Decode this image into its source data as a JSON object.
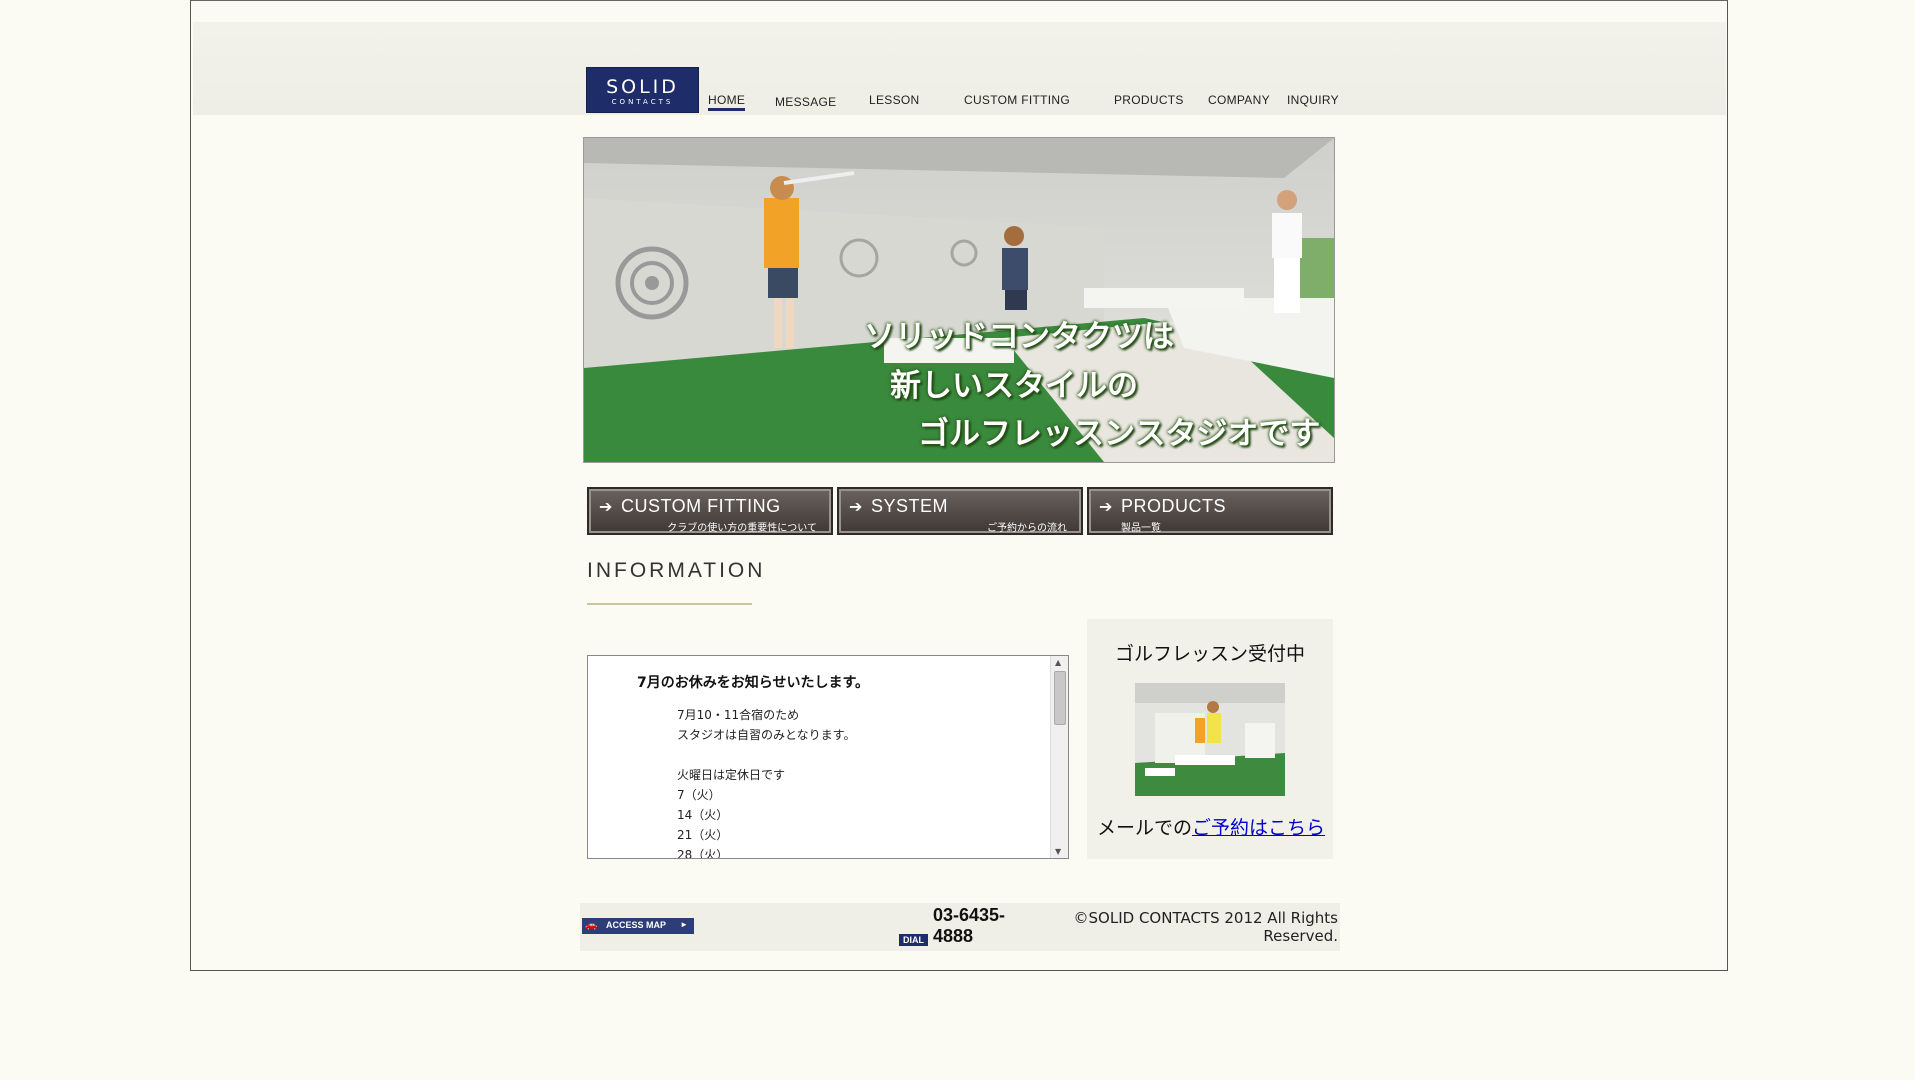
{
  "logo": {
    "line1": "SOLID",
    "line2": "CONTACTS"
  },
  "nav": {
    "items": [
      {
        "label": "HOME",
        "active": true
      },
      {
        "label": "MESSAGE"
      },
      {
        "label": "LESSON"
      },
      {
        "label": "CUSTOM FITTING"
      },
      {
        "label": "PRODUCTS"
      },
      {
        "label": "COMPANY"
      },
      {
        "label": "INQUIRY"
      }
    ]
  },
  "hero": {
    "caption_lines": [
      "ソリッドコンタクツは",
      "新しいスタイルの",
      "ゴルフレッスンスタジオです"
    ]
  },
  "buttons": [
    {
      "arrow": "➔",
      "title": "CUSTOM FITTING",
      "sub": "クラブの使い方の重要性について"
    },
    {
      "arrow": "➔",
      "title": "SYSTEM",
      "sub": "ご予約からの流れ"
    },
    {
      "arrow": "➔",
      "title": "PRODUCTS",
      "sub": "製品一覧"
    }
  ],
  "information": {
    "heading": "INFORMATION",
    "news_title": "7月のお休みをお知らせいたします。",
    "lines": [
      "7月10・11合宿のため",
      "スタジオは自習のみとなります。",
      "",
      "火曜日は定休日です",
      "7（火）",
      "14（火）",
      "21（火）",
      "28（火）"
    ]
  },
  "lesson": {
    "title": "ゴルフレッスン受付中",
    "cta_prefix": "メールでの",
    "cta_link": "ご予約はこちら"
  },
  "footer": {
    "access_map": "ACCESS MAP",
    "dial": "DIAL",
    "phone": "03-6435-4888",
    "copyright": "©SOLID CONTACTS 2012 All Rights Reserved."
  },
  "colors": {
    "brand_navy": "#1e2d6a",
    "background": "#fbfbf3",
    "button_brown": "#4f4744",
    "underline_olive": "#c6c89d",
    "link_blue": "#0000cc"
  }
}
